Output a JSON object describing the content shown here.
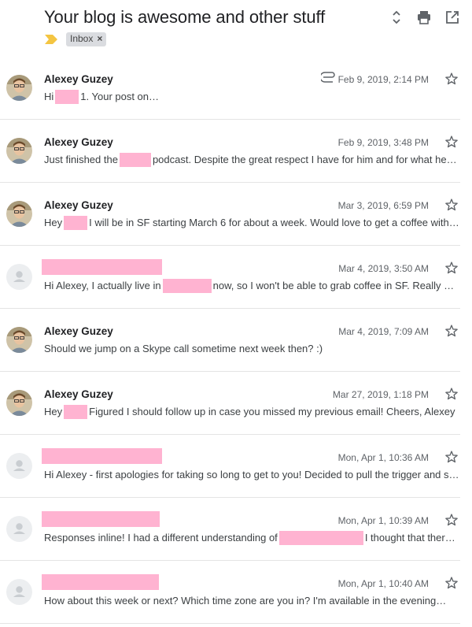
{
  "thread": {
    "subject": "Your blog is awesome and other stuff",
    "label": "Inbox",
    "label_remove": "×"
  },
  "icons": {
    "expand": "unfold-icon",
    "print": "print-icon",
    "open_new_window": "open-in-new-icon",
    "importance": "importance-marker-icon",
    "star": "star-outline-icon",
    "attachment": "paperclip-icon"
  },
  "colors": {
    "redaction": "#ffb3d1",
    "importance": "#f4c542",
    "chip": "#dadce0"
  },
  "messages": [
    {
      "sender": "Alexey Guzey",
      "date": "Feb 9, 2019, 2:14 PM",
      "has_attachment": true,
      "snippet_parts": [
        "Hi",
        "1. Your post on",
        ""
      ]
    },
    {
      "sender": "Alexey Guzey",
      "date": "Feb 9, 2019, 3:48 PM",
      "has_attachment": false,
      "snippet_parts": [
        "Just finished the",
        "podcast. Despite the great respect I have for him and for what he …"
      ]
    },
    {
      "sender": "Alexey Guzey",
      "date": "Mar 3, 2019, 6:59 PM",
      "has_attachment": false,
      "snippet_parts": [
        "Hey",
        "I will be in SF starting March 6 for about a week. Would love to get a coffee with …"
      ]
    },
    {
      "sender": "",
      "date": "Mar 4, 2019, 3:50 AM",
      "has_attachment": false,
      "snippet_parts": [
        "Hi Alexey, I actually live in",
        "now, so I won't be able to grab coffee in SF. Really a…"
      ]
    },
    {
      "sender": "Alexey Guzey",
      "date": "Mar 4, 2019, 7:09 AM",
      "has_attachment": false,
      "snippet_parts": [
        "Should we jump on a Skype call sometime next week then? :)"
      ]
    },
    {
      "sender": "Alexey Guzey",
      "date": "Mar 27, 2019, 1:18 PM",
      "has_attachment": false,
      "snippet_parts": [
        "Hey",
        "Figured I should follow up in case you missed my previous email! Cheers, Alexey"
      ]
    },
    {
      "sender": "",
      "date": "Mon, Apr 1, 10:36 AM",
      "has_attachment": false,
      "snippet_parts": [
        "Hi Alexey - first apologies for taking so long to get to you! Decided to pull the trigger and s…"
      ]
    },
    {
      "sender": "",
      "date": "Mon, Apr 1, 10:39 AM",
      "has_attachment": false,
      "snippet_parts": [
        "Responses inline! I had a different understanding of",
        "I thought that there…"
      ]
    },
    {
      "sender": "",
      "date": "Mon, Apr 1, 10:40 AM",
      "has_attachment": false,
      "snippet_parts": [
        "How about this week or next? Which time zone are you in? I'm available in the evening",
        ""
      ]
    }
  ]
}
